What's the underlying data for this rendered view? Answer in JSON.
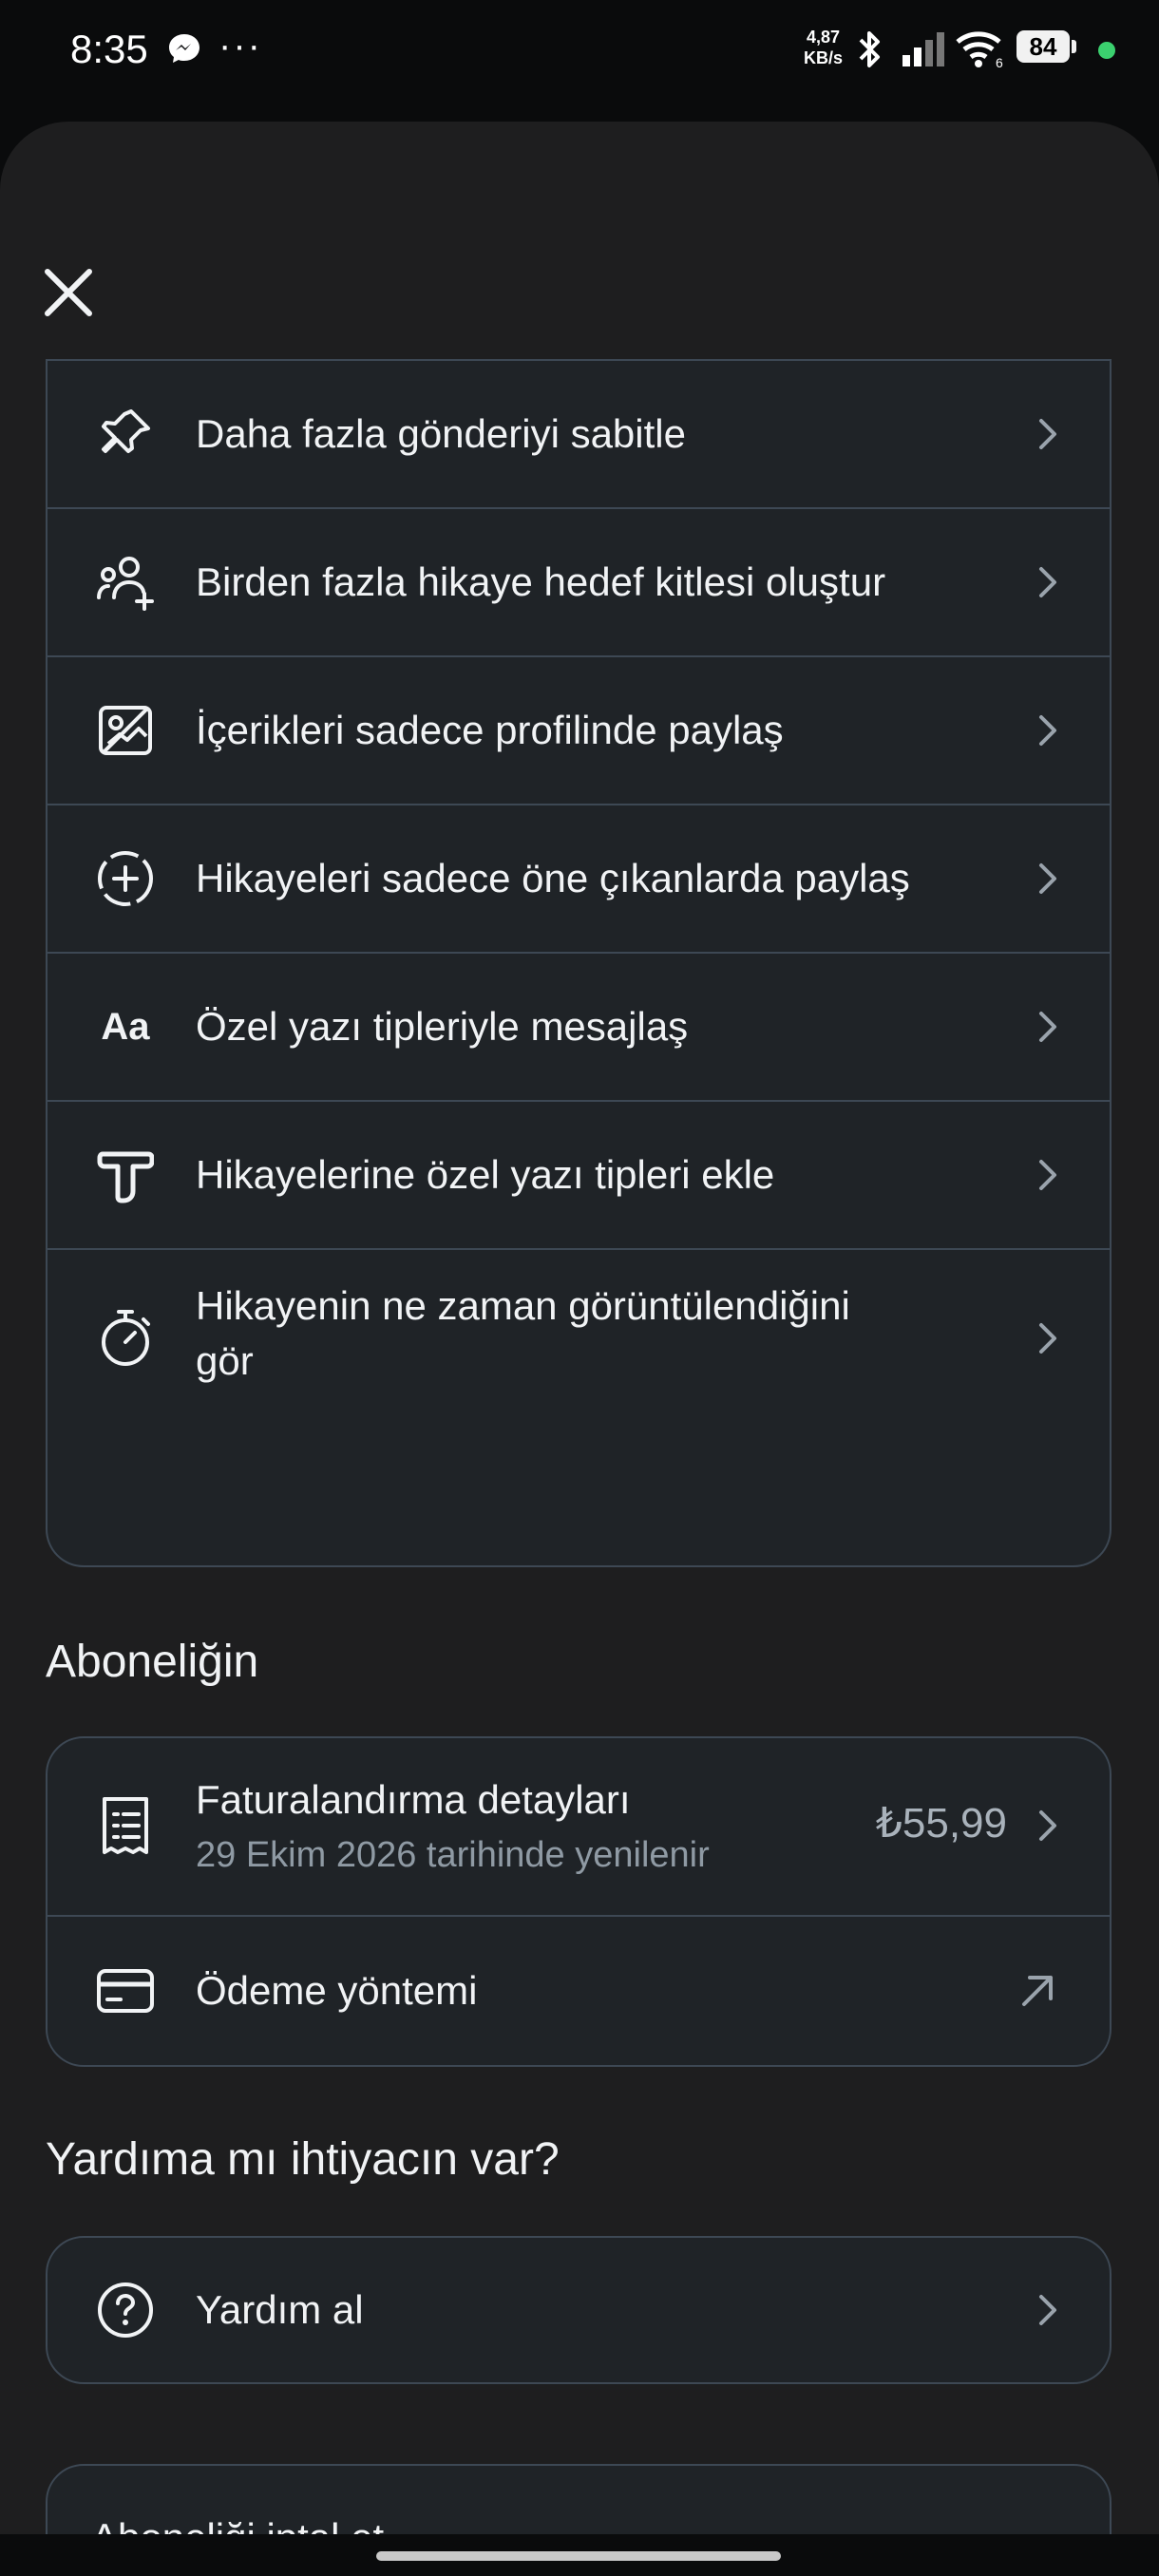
{
  "status_bar": {
    "time": "8:35",
    "dots": "···",
    "speed_value": "4,87",
    "speed_unit": "KB/s",
    "battery": "84",
    "status_color": "#3bd16f"
  },
  "features": [
    {
      "icon": "pin-icon",
      "label": "Daha fazla gönderiyi sabitle"
    },
    {
      "icon": "multi-audience-icon",
      "label": "Birden fazla hikaye hedef kitlesi oluştur"
    },
    {
      "icon": "profile-only-icon",
      "label": "İçerikleri sadece profilinde paylaş"
    },
    {
      "icon": "highlight-add-icon",
      "label": "Hikayeleri sadece öne çıkanlarda paylaş"
    },
    {
      "icon": "font-aa-icon",
      "label": "Özel yazı tipleriyle mesajlaş",
      "glyph": "Aa"
    },
    {
      "icon": "custom-font-icon",
      "label": "Hikayelerine özel yazı tipleri ekle"
    },
    {
      "icon": "stopwatch-icon",
      "label_line1": "Hikayenin ne zaman görüntülendiğini",
      "label_line2": "gör"
    }
  ],
  "subscription": {
    "title": "Aboneliğin",
    "billing_label": "Faturalandırma detayları",
    "billing_sub": "29 Ekim 2026 tarihinde yenilenir",
    "price": "₺55,99",
    "payment_label": "Ödeme yöntemi"
  },
  "help": {
    "title": "Yardıma mı ihtiyacın var?",
    "get_help_label": "Yardım al"
  },
  "cancel": {
    "label": "Aboneliği iptal et"
  },
  "colors": {
    "background": "#1e1e1f",
    "card": "#1f2327",
    "border": "#3d4854",
    "text": "#f1f3f5",
    "muted": "#8f9aa4"
  }
}
